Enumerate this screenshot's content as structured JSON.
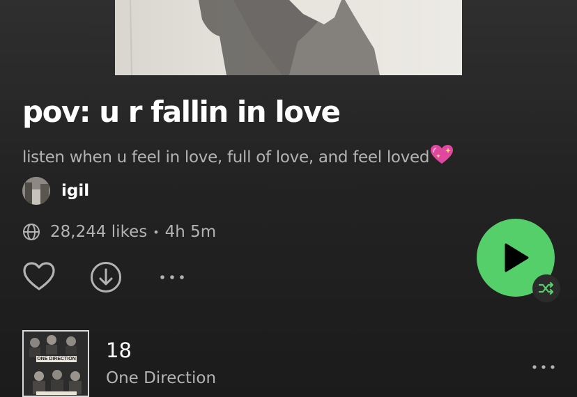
{
  "playlist": {
    "title": "pov: u r fallin in love",
    "description": "listen when u feel in love, full of love, and feel loved",
    "description_emoji": "sparkling-heart-emoji",
    "owner": "igil",
    "likes": "28,244 likes",
    "separator": "•",
    "duration": "4h 5m"
  },
  "actions": {
    "like_icon": "heart-outline-icon",
    "download_icon": "download-circle-icon",
    "more_icon": "more-dots-icon",
    "play_icon": "play-icon",
    "shuffle_icon": "shuffle-icon"
  },
  "tracks": [
    {
      "title": "18",
      "artist": "One Direction",
      "album_art_text": "ONE DIRECTION"
    }
  ],
  "colors": {
    "accent_green": "#55cf6a",
    "background": "#232323",
    "secondary_text": "#b3b3b3",
    "heart_emoji": "#e0479e"
  }
}
